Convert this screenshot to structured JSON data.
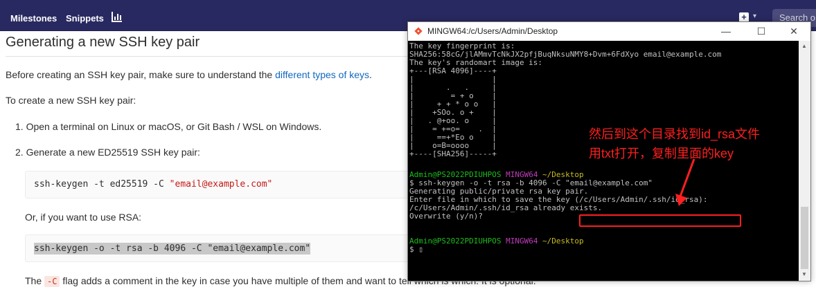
{
  "nav": {
    "milestones": "Milestones",
    "snippets": "Snippets",
    "search_placeholder": "Search o"
  },
  "doc": {
    "heading": "Generating a new SSH key pair",
    "intro_pre": "Before creating an SSH key pair, make sure to understand the ",
    "intro_link": "different types of keys",
    "intro_post": ".",
    "to_create": "To create a new SSH key pair:",
    "step1": "1. Open a terminal on Linux or macOS, or Git Bash / WSL on Windows.",
    "step2": "2. Generate a new ED25519 SSH key pair:",
    "code1_cmd": "ssh-keygen -t ed25519 -C ",
    "code1_str": "\"email@example.com\"",
    "or_rsa": "Or, if you want to use RSA:",
    "code2": "ssh-keygen -o -t rsa -b 4096 -C \"email@example.com\"",
    "flag_pre": "The ",
    "flag_code": "-C",
    "flag_post": " flag adds a comment in the key in case you have multiple of them and want to tell which is which. It is optional."
  },
  "terminal": {
    "title": "MINGW64:/c/Users/Admin/Desktop",
    "minimize": "—",
    "maximize": "☐",
    "close": "✕",
    "lines": [
      "The key fingerprint is:",
      "SHA256:58cG/jlAMmvTcNkJX2pfjBuqNksuNMY8+Dvm+6FdXyo email@example.com",
      "The key's randomart image is:",
      "+---[RSA 4096]----+",
      "|                 |",
      "|       .   .     |",
      "|        = + o    |",
      "|     + + * o o   |",
      "|    +SOo. o +    |",
      "|   . @+oo. o     |",
      "|    = +=o=    .  |",
      "|     ==+*Eo o    |",
      "|    o=B=oooo     |",
      "+----[SHA256]-----+"
    ],
    "prompt1_user": "Admin@PS2022PDIUHPOS",
    "prompt1_env": "MINGW64",
    "prompt1_dir": "~/Desktop",
    "cmd": "$ ssh-keygen -o -t rsa -b 4096 -C \"email@example.com\"",
    "gen": "Generating public/private rsa key pair.",
    "enter": "Enter file in which to save the key (/c/Users/Admin/.ssh/id_rsa):",
    "exists": "/c/Users/Admin/.ssh/id_rsa already exists.",
    "overwrite": "Overwrite (y/n)?",
    "prompt2_user": "Admin@PS2022PDIUHPOS",
    "prompt2_env": "MINGW64",
    "prompt2_dir": "~/Desktop",
    "cursor_line": "$ ▯"
  },
  "annotation": {
    "line1": "然后到这个目录找到id_rsa文件",
    "line2": "用txt打开，复制里面的key",
    "color": "#ff1f1f"
  }
}
